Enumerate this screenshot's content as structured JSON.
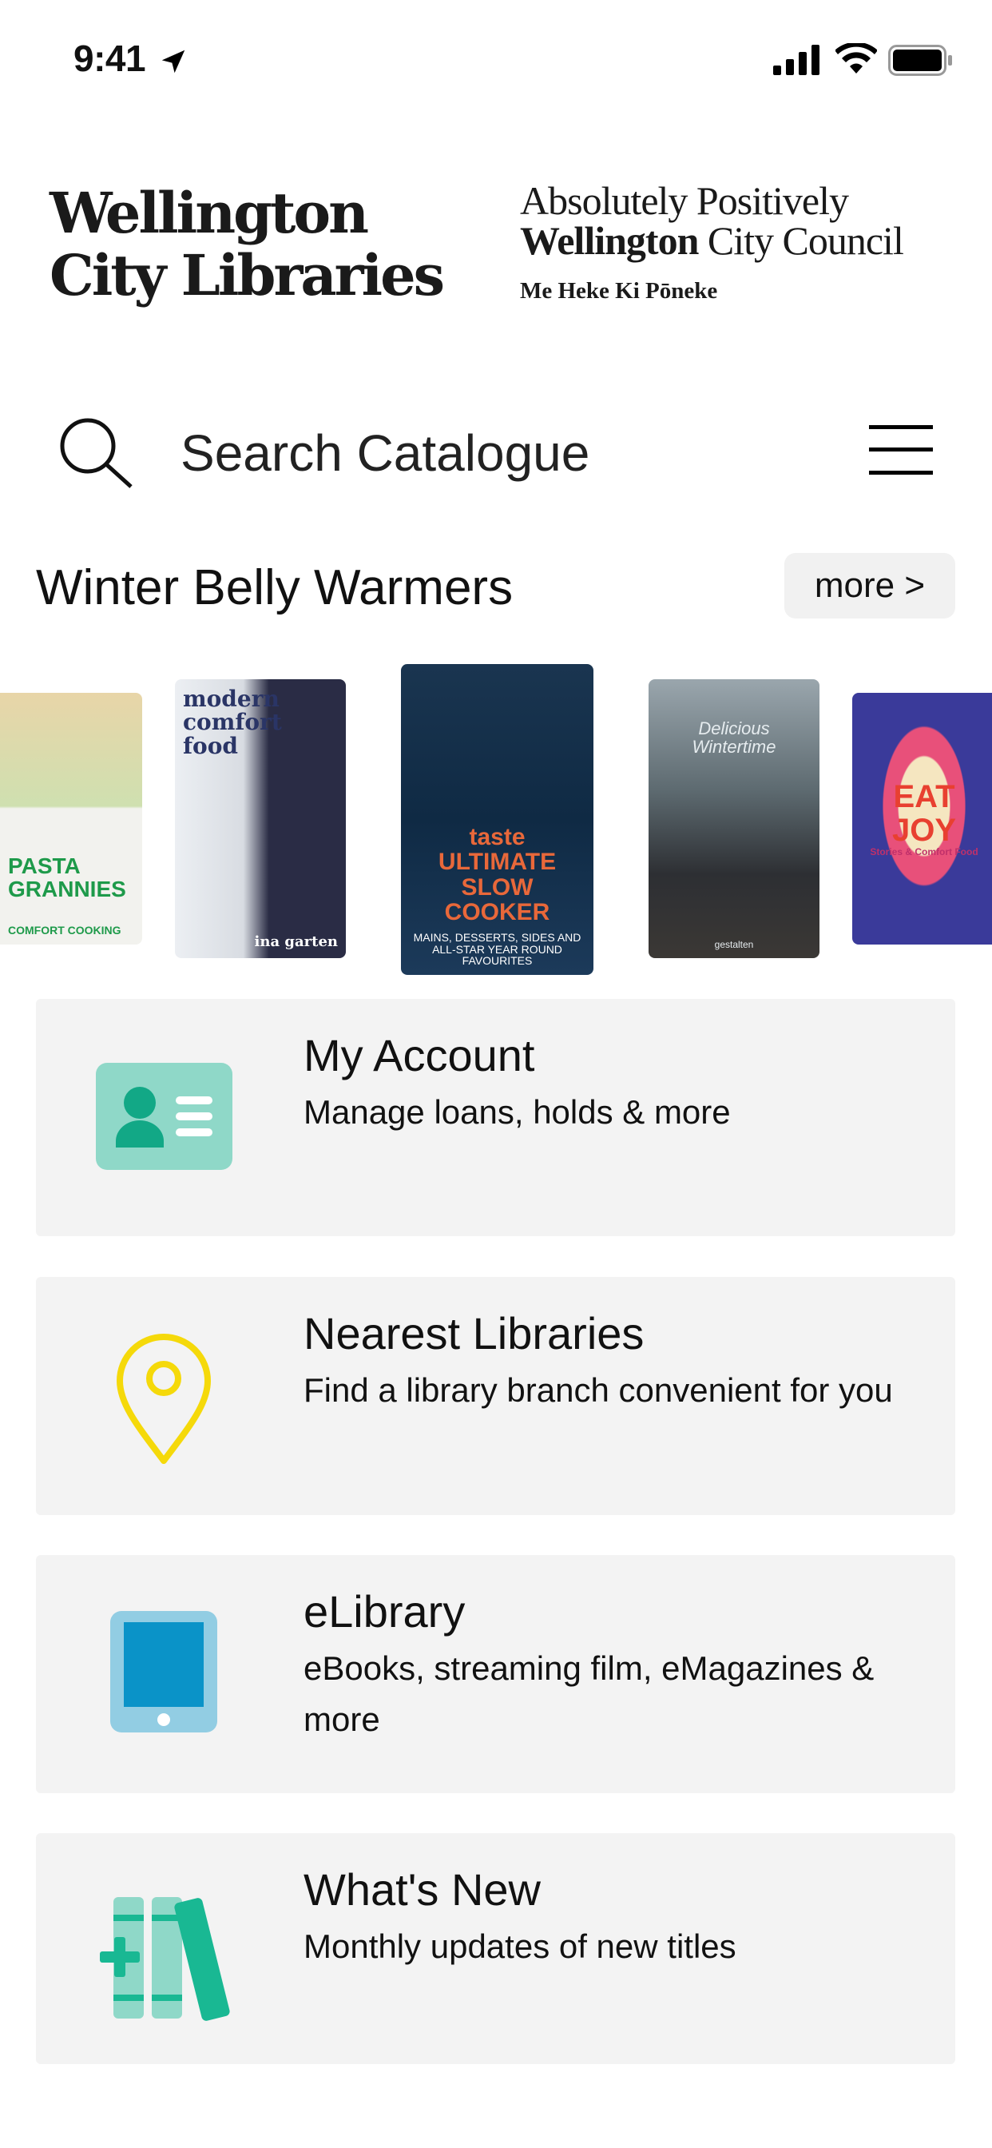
{
  "status_bar": {
    "time": "9:41"
  },
  "header": {
    "logo_left": [
      "Wellington",
      "City Libraries"
    ],
    "logo_right": {
      "line1": "Absolutely Positively",
      "line2_bold": "Wellington",
      "line2_rest": " City Council",
      "line3": "Me Heke Ki Pōneke"
    }
  },
  "search": {
    "placeholder": "Search Catalogue"
  },
  "carousel": {
    "title": "Winter Belly Warmers",
    "more_label": "more >",
    "books": [
      {
        "title": "PASTA GRANNIES",
        "subtitle": "COMFORT COOKING"
      },
      {
        "title": "modern comfort food",
        "subtitle": "ina garten"
      },
      {
        "title": "taste ULTIMATE SLOW COOKER",
        "subtitle": "MAINS, DESSERTS, SIDES AND ALL-STAR YEAR ROUND FAVOURITES"
      },
      {
        "title": "Delicious Wintertime",
        "subtitle": "gestalten"
      },
      {
        "title": "EAT JOY",
        "subtitle": "Stories & Comfort Food"
      }
    ]
  },
  "menu": [
    {
      "title": "My Account",
      "subtitle": "Manage loans, holds & more",
      "icon": "id-card-icon",
      "color": "#8fd8c8"
    },
    {
      "title": "Nearest Libraries",
      "subtitle": "Find a library branch convenient for you",
      "icon": "map-pin-icon",
      "color": "#f5d90a"
    },
    {
      "title": "eLibrary",
      "subtitle": "eBooks, streaming film, eMagazines & more",
      "icon": "tablet-icon",
      "color": "#0a93c8"
    },
    {
      "title": "What's New",
      "subtitle": "Monthly updates of new titles",
      "icon": "books-icon",
      "color": "#19b893"
    }
  ]
}
